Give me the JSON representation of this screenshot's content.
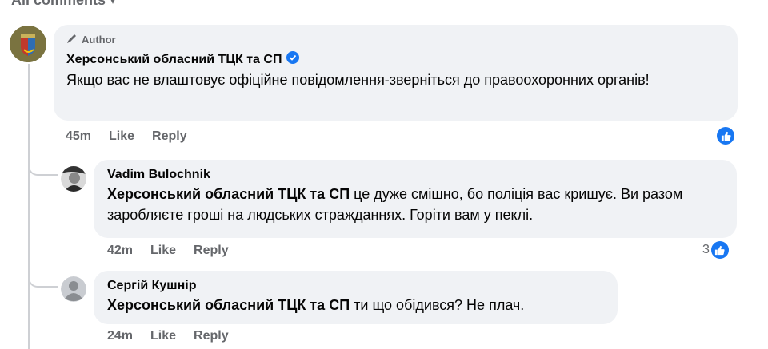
{
  "header": {
    "label": "All comments"
  },
  "comments": [
    {
      "badge": "Author",
      "name": "Херсонський обласний ТЦК та СП",
      "verified": true,
      "text": "Якщо вас не влаштовує офіційне повідомлення-зверніться до правоохоронних органів!",
      "time": "45m",
      "like": "Like",
      "reply": "Reply",
      "reaction_count": ""
    },
    {
      "name": "Vadim Bulochnik",
      "mention": "Херсонський обласний ТЦК та СП",
      "text": " це дуже смішно, бо поліція вас кришує. Ви разом заробляєте гроші на людських стражданнях. Горіти вам у пеклі.",
      "time": "42m",
      "like": "Like",
      "reply": "Reply",
      "reaction_count": "3"
    },
    {
      "name": "Сергій Кушнір",
      "mention": "Херсонський обласний ТЦК та СП",
      "text": " ти що обідився? Не плач.",
      "time": "24m",
      "like": "Like",
      "reply": "Reply",
      "reaction_count": ""
    }
  ],
  "colors": {
    "bubble": "#f0f2f5",
    "accent": "#1877f2",
    "muted": "#65676b"
  }
}
